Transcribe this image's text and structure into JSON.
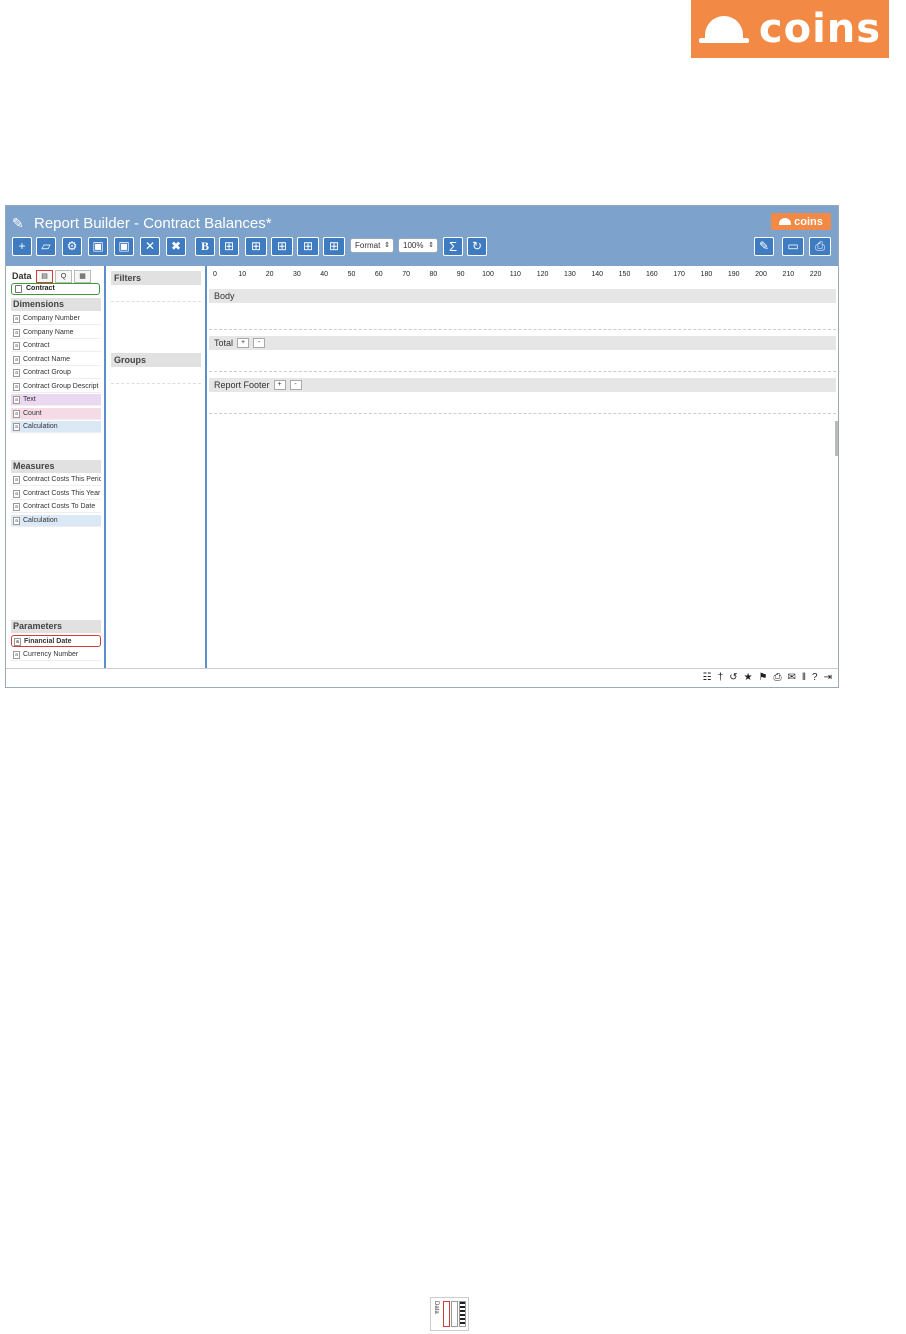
{
  "brand": {
    "name": "coins"
  },
  "window": {
    "title": "Report Builder - Contract Balances*",
    "logo": "coins"
  },
  "toolbar": {
    "buttons": [
      {
        "name": "add-icon",
        "glyph": "+"
      },
      {
        "name": "open-folder-icon",
        "glyph": "▱"
      },
      {
        "name": "settings-gear-icon",
        "glyph": "⚙"
      },
      {
        "name": "save-icon",
        "glyph": "▣"
      },
      {
        "name": "save-as-icon",
        "glyph": "▣"
      },
      {
        "name": "delete-icon",
        "glyph": "✕"
      },
      {
        "name": "close-icon",
        "glyph": "✖"
      }
    ],
    "bold_label": "B",
    "format_select": "Format",
    "zoom_select": "100%",
    "sum_label": "Σ",
    "refresh_glyph": "↻",
    "edit_glyph": "✎",
    "monitor_glyph": "▭",
    "print_glyph": "⎙"
  },
  "left_panel": {
    "data_label": "Data",
    "tabs": [
      "▤",
      "Q",
      "▦"
    ],
    "source": "Contract",
    "dimensions_title": "Dimensions",
    "dimensions": [
      {
        "label": "Company Number",
        "style": ""
      },
      {
        "label": "Company Name",
        "style": ""
      },
      {
        "label": "Contract",
        "style": ""
      },
      {
        "label": "Contract Name",
        "style": ""
      },
      {
        "label": "Contract Group",
        "style": ""
      },
      {
        "label": "Contract Group Descript",
        "style": ""
      },
      {
        "label": "Text",
        "style": "purple"
      },
      {
        "label": "Count",
        "style": "pink"
      },
      {
        "label": "Calculation",
        "style": "blue"
      }
    ],
    "measures_title": "Measures",
    "measures": [
      {
        "label": "Contract Costs This Peric",
        "style": ""
      },
      {
        "label": "Contract Costs This Year",
        "style": ""
      },
      {
        "label": "Contract Costs To Date",
        "style": ""
      },
      {
        "label": "Calculation",
        "style": "blue"
      }
    ],
    "parameters_title": "Parameters",
    "parameters": [
      {
        "label": "Financial Date",
        "style": "redbox"
      },
      {
        "label": "Currency Number",
        "style": ""
      }
    ]
  },
  "middle_panel": {
    "filters_title": "Filters",
    "groups_title": "Groups"
  },
  "canvas": {
    "ruler": [
      "0",
      "10",
      "20",
      "30",
      "40",
      "50",
      "60",
      "70",
      "80",
      "90",
      "100",
      "110",
      "120",
      "130",
      "140",
      "150",
      "160",
      "170",
      "180",
      "190",
      "200",
      "210",
      "220"
    ],
    "body_label": "Body",
    "total_label": "Total",
    "footer_label": "Report Footer",
    "plus": "+",
    "minus": "-"
  },
  "status_bar": {
    "icons": [
      "☷",
      "†",
      "↺",
      "★",
      "⚑",
      "⎙",
      "✉",
      "‖",
      "?",
      "⇥"
    ]
  },
  "thumbnail": {
    "label": "Data"
  }
}
